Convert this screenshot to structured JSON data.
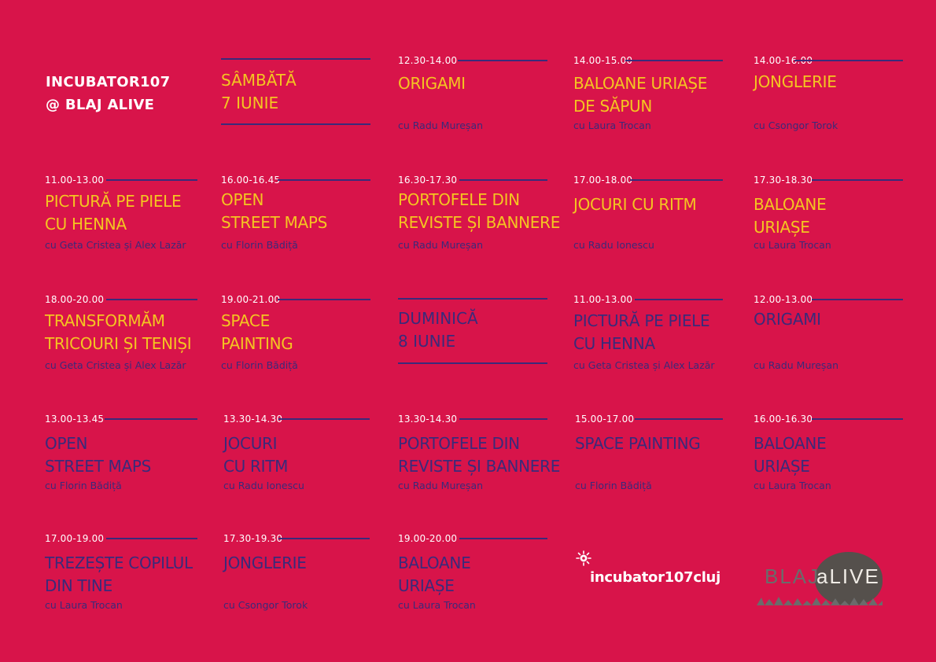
{
  "header": {
    "line1": "INCUBATOR107",
    "line2": "@ BLAJ  ALIVE"
  },
  "days": {
    "saturday": {
      "name": "SÂMBĂTĂ",
      "date": "7 IUNIE"
    },
    "sunday": {
      "name": "DUMINICĂ",
      "date": "8 IUNIE"
    }
  },
  "sessions": [
    {
      "time": "12.30-14.00",
      "title": [
        "ORIGAMI"
      ],
      "host": "cu Radu Mureșan"
    },
    {
      "time": "14.00-15.00",
      "title": [
        "BALOANE URIAȘE",
        "DE SĂPUN"
      ],
      "host": "cu Laura Trocan"
    },
    {
      "time": "14.00-16.00",
      "title": [
        "JONGLERIE"
      ],
      "host": "cu Csongor Torok"
    },
    {
      "time": "11.00-13.00",
      "title": [
        "PICTURĂ PE PIELE",
        "CU HENNA"
      ],
      "host": "cu Geta Cristea și Alex Lazăr"
    },
    {
      "time": "16.00-16.45",
      "title": [
        "OPEN",
        "STREET MAPS"
      ],
      "host": "cu Florin Bădiță"
    },
    {
      "time": "16.30-17.30",
      "title": [
        "PORTOFELE DIN",
        "REVISTE ȘI BANNERE"
      ],
      "host": "cu Radu Mureșan"
    },
    {
      "time": "17.00-18.00",
      "title": [
        "JOCURI CU RITM"
      ],
      "host": "cu Radu Ionescu"
    },
    {
      "time": "17.30-18.30",
      "title": [
        "BALOANE",
        "URIAȘE"
      ],
      "host": "cu Laura Trocan"
    },
    {
      "time": "18.00-20.00",
      "title": [
        "TRANSFORMĂM",
        "TRICOURI ȘI TENIȘI"
      ],
      "host": "cu Geta Cristea și Alex Lazăr"
    },
    {
      "time": "19.00-21.00",
      "title": [
        "SPACE",
        "PAINTING"
      ],
      "host": "cu Florin Bădiță"
    },
    {
      "time": "11.00-13.00",
      "title": [
        "PICTURĂ PE PIELE",
        "CU HENNA"
      ],
      "host": "cu Geta Cristea și Alex Lazăr"
    },
    {
      "time": "12.00-13.00",
      "title": [
        "ORIGAMI"
      ],
      "host": "cu Radu Mureșan"
    },
    {
      "time": "13.00-13.45",
      "title": [
        "OPEN",
        "STREET MAPS"
      ],
      "host": "cu Florin Bădiță"
    },
    {
      "time": "13.30-14.30",
      "title": [
        "JOCURI",
        "CU RITM"
      ],
      "host": "cu Radu Ionescu"
    },
    {
      "time": "13.30-14.30",
      "title": [
        "PORTOFELE DIN",
        "REVISTE ȘI BANNERE"
      ],
      "host": "cu Radu Mureșan"
    },
    {
      "time": "15.00-17.00",
      "title": [
        "SPACE PAINTING"
      ],
      "host": "cu Florin Bădiță"
    },
    {
      "time": "16.00-16.30",
      "title": [
        "BALOANE",
        "URIAȘE"
      ],
      "host": "cu Laura Trocan"
    },
    {
      "time": "17.00-19.00",
      "title": [
        "TREZEȘTE COPILUL",
        "DIN TINE"
      ],
      "host": "cu Laura Trocan"
    },
    {
      "time": "17.30-19.30",
      "title": [
        "JONGLERIE"
      ],
      "host": "cu Csongor Torok"
    },
    {
      "time": "19.00-20.00",
      "title": [
        "BALOANE",
        "URIAȘE"
      ],
      "host": "cu Laura Trocan"
    }
  ],
  "logos": {
    "incubator": "incubator107cluj",
    "blaj": "BLAJ",
    "alive": "aLIVE"
  },
  "colors": {
    "background": "#d8144a",
    "saturday_title": "#f4c521",
    "sunday_title": "#3a2a7a",
    "host_text": "#3a2a7a",
    "time_text": "#ffffff",
    "rule_line": "#3a2a7a"
  },
  "icons": [
    "incubator-logo-icon",
    "grass-icon"
  ]
}
